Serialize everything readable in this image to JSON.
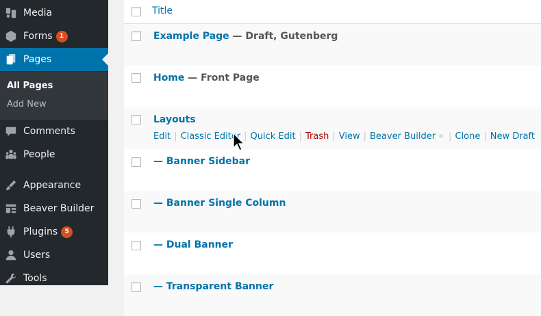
{
  "sidebar": {
    "items": [
      {
        "label": "Media",
        "icon": "media-icon"
      },
      {
        "label": "Forms",
        "icon": "forms-icon",
        "badge": "1"
      },
      {
        "label": "Pages",
        "icon": "pages-icon"
      },
      {
        "label": "Comments",
        "icon": "comments-icon"
      },
      {
        "label": "People",
        "icon": "people-icon"
      },
      {
        "label": "Appearance",
        "icon": "appearance-icon"
      },
      {
        "label": "Beaver Builder",
        "icon": "beaver-builder-icon"
      },
      {
        "label": "Plugins",
        "icon": "plugins-icon",
        "badge": "5"
      },
      {
        "label": "Users",
        "icon": "users-icon"
      },
      {
        "label": "Tools",
        "icon": "tools-icon"
      }
    ],
    "submenu": [
      {
        "label": "All Pages"
      },
      {
        "label": "Add New"
      }
    ]
  },
  "table": {
    "header_title": "Title",
    "rows": [
      {
        "title": "Example Page",
        "state": " — Draft, Gutenberg"
      },
      {
        "title": "Home",
        "state": " — Front Page"
      },
      {
        "title": "Layouts",
        "state": ""
      },
      {
        "title": "— Banner Sidebar",
        "state": ""
      },
      {
        "title": "— Banner Single Column",
        "state": ""
      },
      {
        "title": "— Dual Banner",
        "state": ""
      },
      {
        "title": "— Transparent Banner",
        "state": ""
      }
    ],
    "row_actions": {
      "edit": "Edit",
      "classic_editor": "Classic Editor",
      "quick_edit": "Quick Edit",
      "trash": "Trash",
      "view": "View",
      "beaver_builder": "Beaver Builder",
      "clone": "Clone",
      "new_draft": "New Draft"
    }
  },
  "colors": {
    "sidebar_bg": "#23282d",
    "submenu_bg": "#32373c",
    "accent": "#0073aa",
    "trash": "#aa0000",
    "badge": "#d54e21"
  }
}
